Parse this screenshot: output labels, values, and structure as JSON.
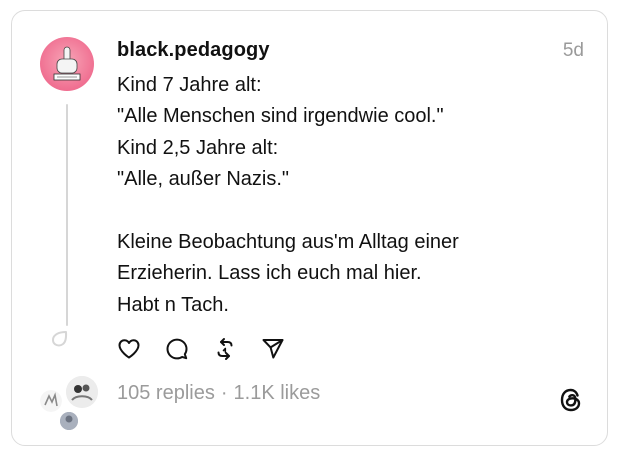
{
  "post": {
    "username": "black.pedagogy",
    "time_ago": "5d",
    "lines": [
      "Kind 7 Jahre alt:",
      "\"Alle Menschen sind irgendwie cool.\"",
      "Kind 2,5 Jahre alt:",
      "\"Alle, außer Nazis.\"",
      "",
      "Kleine Beobachtung aus'm Alltag einer",
      "Erzieherin. Lass ich euch mal hier.",
      "Habt n Tach."
    ],
    "stats": {
      "replies": "105 replies",
      "separator": "·",
      "likes": "1.1K likes"
    }
  },
  "actions": [
    {
      "name": "like-button",
      "icon": "heart-icon"
    },
    {
      "name": "reply-button",
      "icon": "speech-bubble-icon"
    },
    {
      "name": "repost-button",
      "icon": "repost-icon"
    },
    {
      "name": "share-button",
      "icon": "paper-plane-icon"
    }
  ],
  "colors": {
    "text": "#111111",
    "muted": "#9b9b9b",
    "border": "#dcdcdc",
    "avatar_pink": "#f06f91"
  }
}
